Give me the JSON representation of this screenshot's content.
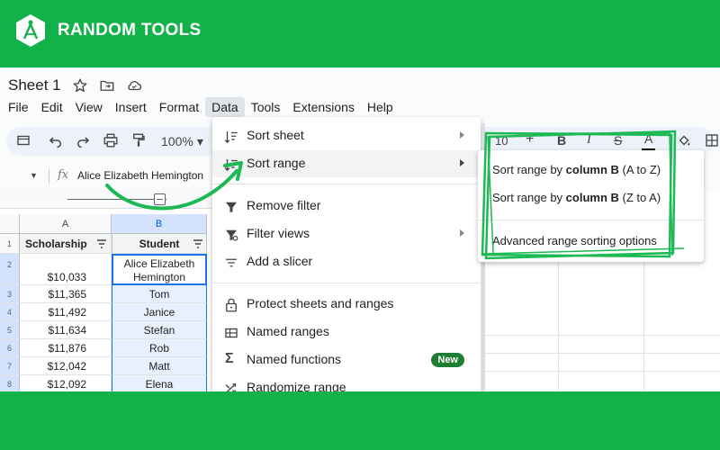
{
  "brand": {
    "name": "RANDOM TOOLS",
    "logo_icon": "compass-hexagon-icon",
    "color": "#12b24b"
  },
  "doc": {
    "title": "Sheet 1"
  },
  "menubar": [
    "File",
    "Edit",
    "View",
    "Insert",
    "Format",
    "Data",
    "Tools",
    "Extensions",
    "Help"
  ],
  "toolbar": {
    "zoom": "100%",
    "font_size": "10",
    "plus": "+",
    "bold": "B",
    "italic": "I",
    "strike": "S",
    "text_color": "A"
  },
  "formula": {
    "fx": "fx",
    "value": "Alice Elizabeth Hemington"
  },
  "grid": {
    "col_a": "A",
    "col_b": "B",
    "header_a": "Scholarship",
    "header_b": "Student",
    "row_labels": [
      "1",
      "2",
      "3",
      "4",
      "5",
      "6",
      "7",
      "8"
    ],
    "rows": [
      {
        "a": "$10,033",
        "b1": "Alice Elizabeth",
        "b2": "Hemington"
      },
      {
        "a": "$11,365",
        "b": "Tom"
      },
      {
        "a": "$11,492",
        "b": "Janice"
      },
      {
        "a": "$11,634",
        "b": "Stefan"
      },
      {
        "a": "$11,876",
        "b": "Rob"
      },
      {
        "a": "$12,042",
        "b": "Matt"
      },
      {
        "a": "$12,092",
        "b": "Elena"
      }
    ]
  },
  "data_menu": {
    "sort_sheet": "Sort sheet",
    "sort_range": "Sort range",
    "remove_filter": "Remove filter",
    "filter_views": "Filter views",
    "add_slicer": "Add a slicer",
    "protect": "Protect sheets and ranges",
    "named_ranges": "Named ranges",
    "named_functions": "Named functions",
    "new_badge": "New",
    "randomize": "Randomize range"
  },
  "submenu": {
    "az_prefix": "Sort range by ",
    "az_bold": "column B",
    "az_suffix": " (A to Z)",
    "za_prefix": "Sort range by ",
    "za_bold": "column B",
    "za_suffix": " (Z to A)",
    "advanced": "Advanced range sorting options"
  },
  "annotation_color": "#1db954"
}
